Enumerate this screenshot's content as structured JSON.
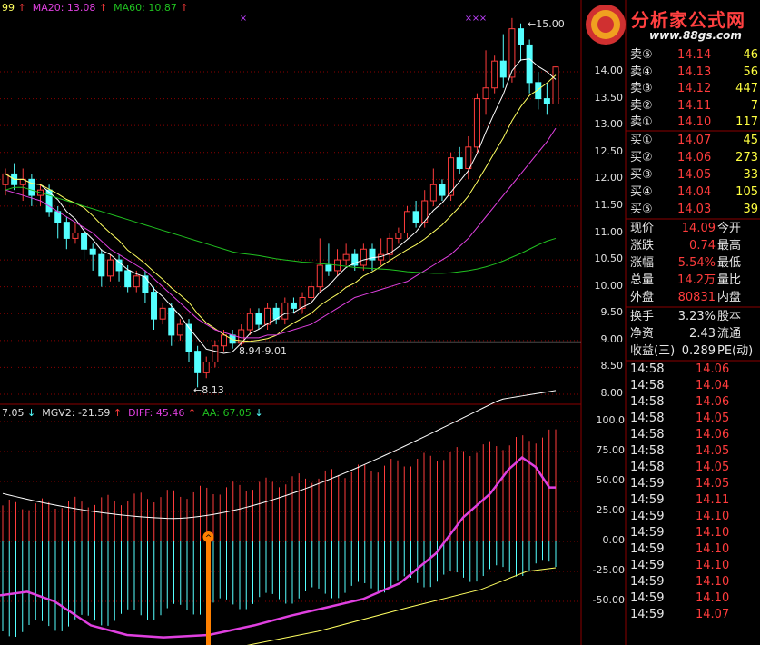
{
  "colors": {
    "up": "#ff3c3c",
    "down": "#54ffff",
    "ma5": "#ffffff",
    "ma10": "#ffff60",
    "ma20": "#e040e0",
    "ma60": "#20c020",
    "diff": "#e040e0",
    "aa": "#ffff60",
    "bar_up": "#ff3c3c",
    "bar_down": "#54ffff",
    "grid": "#8b0000",
    "signal": "#ff8000"
  },
  "logo": {
    "title": "分析家公式网",
    "url": "www.88gs.com"
  },
  "top_legend": {
    "ma_first": "99",
    "ma20": "MA20: 13.08",
    "ma60": "MA60: 10.87"
  },
  "top_annotations": {
    "high": "15.00",
    "low": "8.13",
    "range": "8.94-9.01"
  },
  "price_axis": [
    "14.00",
    "13.50",
    "13.00",
    "12.50",
    "12.00",
    "11.50",
    "11.00",
    "10.50",
    "10.00",
    "9.50",
    "9.00",
    "8.50",
    "8.00"
  ],
  "bottom_legend": {
    "first": "7.05",
    "mgv2": "MGV2: -21.59",
    "diff": "DIFF: 45.46",
    "aa": "AA: 67.05"
  },
  "osc_axis": [
    "100.0",
    "75.00",
    "50.00",
    "25.00",
    "0.00",
    "-25.00",
    "-50.00"
  ],
  "order_book": {
    "sell": [
      {
        "label": "卖⑤",
        "price": "14.14",
        "vol": "46"
      },
      {
        "label": "卖④",
        "price": "14.13",
        "vol": "56"
      },
      {
        "label": "卖③",
        "price": "14.12",
        "vol": "447"
      },
      {
        "label": "卖②",
        "price": "14.11",
        "vol": "7"
      },
      {
        "label": "卖①",
        "price": "14.10",
        "vol": "117"
      }
    ],
    "buy": [
      {
        "label": "买①",
        "price": "14.07",
        "vol": "45"
      },
      {
        "label": "买②",
        "price": "14.06",
        "vol": "273"
      },
      {
        "label": "买③",
        "price": "14.05",
        "vol": "33"
      },
      {
        "label": "买④",
        "price": "14.04",
        "vol": "105"
      },
      {
        "label": "买⑤",
        "price": "14.03",
        "vol": "39"
      }
    ]
  },
  "quote": [
    {
      "l1": "现价",
      "v1": "14.09",
      "l2": "今开"
    },
    {
      "l1": "涨跌",
      "v1": "0.74",
      "l2": "最高"
    },
    {
      "l1": "涨幅",
      "v1": "5.54%",
      "l2": "最低"
    },
    {
      "l1": "总量",
      "v1": "14.2万",
      "l2": "量比"
    },
    {
      "l1": "外盘",
      "v1": "80831",
      "l2": "内盘"
    }
  ],
  "stats": [
    {
      "l1": "换手",
      "v1": "3.23%",
      "l2": "股本"
    },
    {
      "l1": "净资",
      "v1": "2.43",
      "l2": "流通"
    },
    {
      "l1": "收益(三)",
      "v1": "0.289",
      "l2": "PE(动)"
    }
  ],
  "ticks": [
    {
      "time": "14:58",
      "price": "14.06"
    },
    {
      "time": "14:58",
      "price": "14.04"
    },
    {
      "time": "14:58",
      "price": "14.06"
    },
    {
      "time": "14:58",
      "price": "14.05"
    },
    {
      "time": "14:58",
      "price": "14.06"
    },
    {
      "time": "14:58",
      "price": "14.05"
    },
    {
      "time": "14:58",
      "price": "14.05"
    },
    {
      "time": "14:59",
      "price": "14.05"
    },
    {
      "time": "14:59",
      "price": "14.11"
    },
    {
      "time": "14:59",
      "price": "14.10"
    },
    {
      "time": "14:59",
      "price": "14.10"
    },
    {
      "time": "14:59",
      "price": "14.10"
    },
    {
      "time": "14:59",
      "price": "14.10"
    },
    {
      "time": "14:59",
      "price": "14.10"
    },
    {
      "time": "14:59",
      "price": "14.10"
    },
    {
      "time": "14:59",
      "price": "14.07"
    }
  ],
  "candles": [
    [
      11.9,
      12.1,
      11.7,
      12.2
    ],
    [
      12.1,
      11.9,
      11.8,
      12.3
    ],
    [
      11.9,
      12.0,
      11.6,
      12.2
    ],
    [
      12.0,
      11.7,
      11.5,
      12.1
    ],
    [
      11.7,
      11.8,
      11.5,
      11.9
    ],
    [
      11.8,
      11.4,
      11.3,
      11.9
    ],
    [
      11.4,
      11.2,
      10.9,
      11.5
    ],
    [
      11.2,
      10.9,
      10.7,
      11.3
    ],
    [
      10.9,
      11.0,
      10.8,
      11.2
    ],
    [
      11.0,
      10.7,
      10.5,
      11.1
    ],
    [
      10.7,
      10.6,
      10.3,
      10.8
    ],
    [
      10.6,
      10.2,
      10.0,
      10.7
    ],
    [
      10.2,
      10.5,
      10.1,
      10.6
    ],
    [
      10.5,
      10.3,
      10.1,
      10.6
    ],
    [
      10.3,
      10.0,
      9.9,
      10.4
    ],
    [
      10.0,
      10.2,
      9.9,
      10.3
    ],
    [
      10.2,
      9.9,
      9.7,
      10.3
    ],
    [
      9.9,
      9.4,
      9.2,
      10.0
    ],
    [
      9.4,
      9.6,
      9.3,
      9.7
    ],
    [
      9.6,
      9.1,
      8.9,
      9.7
    ],
    [
      9.1,
      9.3,
      9.0,
      9.4
    ],
    [
      9.3,
      8.8,
      8.6,
      9.4
    ],
    [
      8.8,
      8.4,
      8.13,
      8.9
    ],
    [
      8.4,
      8.6,
      8.3,
      8.7
    ],
    [
      8.6,
      8.9,
      8.5,
      9.0
    ],
    [
      8.9,
      9.1,
      8.8,
      9.2
    ],
    [
      9.1,
      8.95,
      8.85,
      9.2
    ],
    [
      8.95,
      9.2,
      8.9,
      9.3
    ],
    [
      9.2,
      9.5,
      9.1,
      9.6
    ],
    [
      9.5,
      9.3,
      9.2,
      9.6
    ],
    [
      9.3,
      9.6,
      9.2,
      9.7
    ],
    [
      9.6,
      9.4,
      9.3,
      9.7
    ],
    [
      9.4,
      9.7,
      9.3,
      9.8
    ],
    [
      9.7,
      9.6,
      9.5,
      9.8
    ],
    [
      9.6,
      9.8,
      9.5,
      9.9
    ],
    [
      9.8,
      10.0,
      9.7,
      10.1
    ],
    [
      10.0,
      10.4,
      9.9,
      10.9
    ],
    [
      10.4,
      10.3,
      10.2,
      10.8
    ],
    [
      10.3,
      10.5,
      10.2,
      10.7
    ],
    [
      10.5,
      10.6,
      10.4,
      10.8
    ],
    [
      10.6,
      10.4,
      10.3,
      10.7
    ],
    [
      10.4,
      10.7,
      10.3,
      10.8
    ],
    [
      10.7,
      10.5,
      10.3,
      10.8
    ],
    [
      10.5,
      10.6,
      10.4,
      10.9
    ],
    [
      10.6,
      10.9,
      10.5,
      11.0
    ],
    [
      10.9,
      11.0,
      10.8,
      11.1
    ],
    [
      11.0,
      11.4,
      10.9,
      11.5
    ],
    [
      11.4,
      11.2,
      11.1,
      11.6
    ],
    [
      11.2,
      11.6,
      11.1,
      11.8
    ],
    [
      11.6,
      11.9,
      11.5,
      12.2
    ],
    [
      11.9,
      11.7,
      11.6,
      12.0
    ],
    [
      11.7,
      12.4,
      11.6,
      12.5
    ],
    [
      12.4,
      12.2,
      12.1,
      12.6
    ],
    [
      12.2,
      12.6,
      12.0,
      12.8
    ],
    [
      12.6,
      13.5,
      12.5,
      13.6
    ],
    [
      13.5,
      13.7,
      13.2,
      14.4
    ],
    [
      13.7,
      14.2,
      13.6,
      14.3
    ],
    [
      14.2,
      13.9,
      13.7,
      14.7
    ],
    [
      13.9,
      14.8,
      13.8,
      15.0
    ],
    [
      14.8,
      14.5,
      14.2,
      14.9
    ],
    [
      14.5,
      13.8,
      13.6,
      14.6
    ],
    [
      13.8,
      13.5,
      13.3,
      14.0
    ],
    [
      13.5,
      13.4,
      13.2,
      13.8
    ],
    [
      13.4,
      14.09,
      13.4,
      14.1
    ]
  ]
}
